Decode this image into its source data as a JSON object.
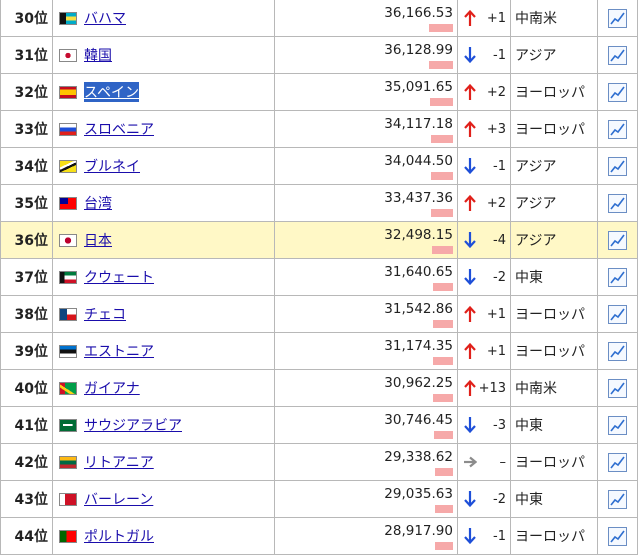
{
  "rows": [
    {
      "rank": "30位",
      "name": "バハマ",
      "value": "36,166.53",
      "value_num": 36166.53,
      "dir": "up",
      "change": "+1",
      "region": "中南米",
      "flag": "bahamas-flag-icon",
      "highlight": false,
      "selected": false
    },
    {
      "rank": "31位",
      "name": "韓国",
      "value": "36,128.99",
      "value_num": 36128.99,
      "dir": "down",
      "change": "-1",
      "region": "アジア",
      "flag": "korea-flag-icon",
      "highlight": false,
      "selected": false
    },
    {
      "rank": "32位",
      "name": "スペイン",
      "value": "35,091.65",
      "value_num": 35091.65,
      "dir": "up",
      "change": "+2",
      "region": "ヨーロッパ",
      "flag": "spain-flag-icon",
      "highlight": false,
      "selected": true
    },
    {
      "rank": "33位",
      "name": "スロベニア",
      "value": "34,117.18",
      "value_num": 34117.18,
      "dir": "up",
      "change": "+3",
      "region": "ヨーロッパ",
      "flag": "slovenia-flag-icon",
      "highlight": false,
      "selected": false
    },
    {
      "rank": "34位",
      "name": "ブルネイ",
      "value": "34,044.50",
      "value_num": 34044.5,
      "dir": "down",
      "change": "-1",
      "region": "アジア",
      "flag": "brunei-flag-icon",
      "highlight": false,
      "selected": false
    },
    {
      "rank": "35位",
      "name": "台湾",
      "value": "33,437.36",
      "value_num": 33437.36,
      "dir": "up",
      "change": "+2",
      "region": "アジア",
      "flag": "taiwan-flag-icon",
      "highlight": false,
      "selected": false
    },
    {
      "rank": "36位",
      "name": "日本",
      "value": "32,498.15",
      "value_num": 32498.15,
      "dir": "down",
      "change": "-4",
      "region": "アジア",
      "flag": "japan-flag-icon",
      "highlight": true,
      "selected": false
    },
    {
      "rank": "37位",
      "name": "クウェート",
      "value": "31,640.65",
      "value_num": 31640.65,
      "dir": "down",
      "change": "-2",
      "region": "中東",
      "flag": "kuwait-flag-icon",
      "highlight": false,
      "selected": false
    },
    {
      "rank": "38位",
      "name": "チェコ",
      "value": "31,542.86",
      "value_num": 31542.86,
      "dir": "up",
      "change": "+1",
      "region": "ヨーロッパ",
      "flag": "czech-flag-icon",
      "highlight": false,
      "selected": false
    },
    {
      "rank": "39位",
      "name": "エストニア",
      "value": "31,174.35",
      "value_num": 31174.35,
      "dir": "up",
      "change": "+1",
      "region": "ヨーロッパ",
      "flag": "estonia-flag-icon",
      "highlight": false,
      "selected": false
    },
    {
      "rank": "40位",
      "name": "ガイアナ",
      "value": "30,962.25",
      "value_num": 30962.25,
      "dir": "up",
      "change": "+13",
      "region": "中南米",
      "flag": "guyana-flag-icon",
      "highlight": false,
      "selected": false
    },
    {
      "rank": "41位",
      "name": "サウジアラビア",
      "value": "30,746.45",
      "value_num": 30746.45,
      "dir": "down",
      "change": "-3",
      "region": "中東",
      "flag": "saudi-flag-icon",
      "highlight": false,
      "selected": false
    },
    {
      "rank": "42位",
      "name": "リトアニア",
      "value": "29,338.62",
      "value_num": 29338.62,
      "dir": "same",
      "change": "–",
      "region": "ヨーロッパ",
      "flag": "lithuania-flag-icon",
      "highlight": false,
      "selected": false
    },
    {
      "rank": "43位",
      "name": "バーレーン",
      "value": "29,035.63",
      "value_num": 29035.63,
      "dir": "down",
      "change": "-2",
      "region": "中東",
      "flag": "bahrain-flag-icon",
      "highlight": false,
      "selected": false
    },
    {
      "rank": "44位",
      "name": "ポルトガル",
      "value": "28,917.90",
      "value_num": 28917.9,
      "dir": "down",
      "change": "-1",
      "region": "ヨーロッパ",
      "flag": "portugal-flag-icon",
      "highlight": false,
      "selected": false
    }
  ],
  "colors": {
    "up": "#e0201a",
    "down": "#1e4fd8",
    "same": "#8c8c8c",
    "bar": "#f6a9a9",
    "highlight": "#fff8c6",
    "link": "#1a0dab"
  },
  "icons": {
    "graph": "line-chart-icon",
    "up": "arrow-up-icon",
    "down": "arrow-down-icon",
    "same": "arrow-right-icon"
  }
}
